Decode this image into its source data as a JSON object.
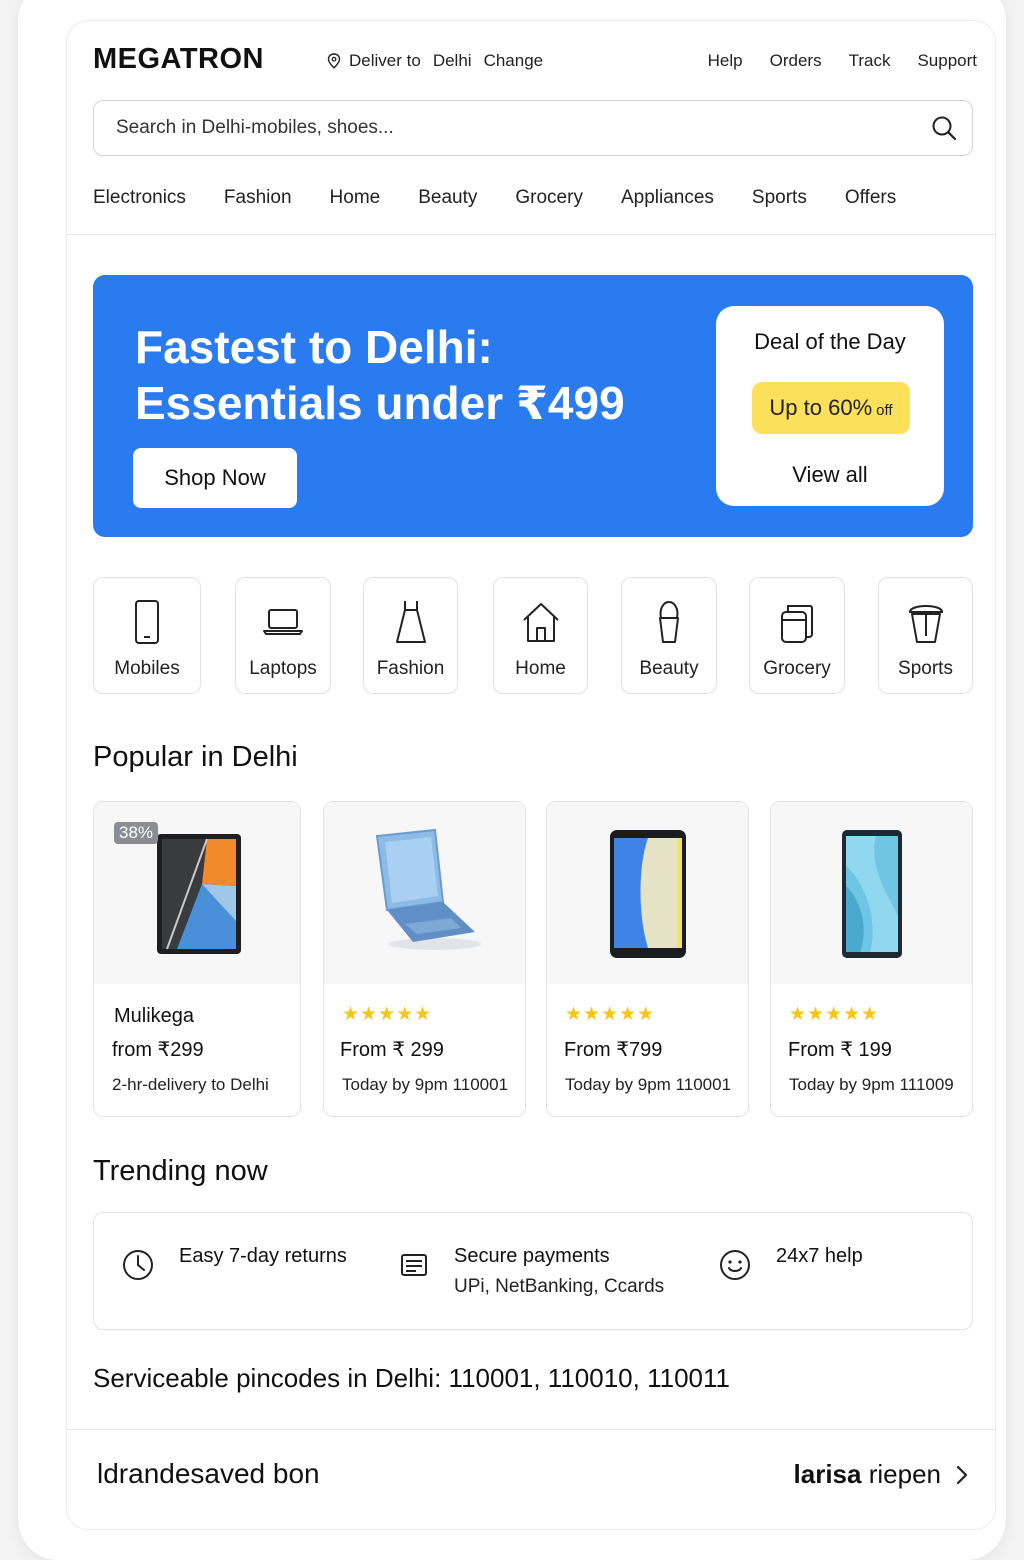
{
  "header": {
    "logo": "MEGATRON",
    "deliver_label": "Deliver to",
    "deliver_city": "Delhi",
    "change_label": "Change",
    "links": [
      "Help",
      "Orders",
      "Track",
      "Support"
    ]
  },
  "search": {
    "placeholder": "Search in Delhi-mobiles, shoes..."
  },
  "nav": [
    "Electronics",
    "Fashion",
    "Home",
    "Beauty",
    "Grocery",
    "Appliances",
    "Sports",
    "Offers"
  ],
  "hero": {
    "title_line1": "Fastest to Delhi:",
    "title_line2": "Essentials under ₹499",
    "cta": "Shop Now",
    "deal_title": "Deal of the Day",
    "deal_badge": "Up to 60%",
    "deal_badge_suffix": "off",
    "deal_link": "View all",
    "color": "#2a7bef",
    "badge_color": "#fde05a"
  },
  "categories": [
    {
      "label": "Mobiles",
      "icon": "mobile-icon"
    },
    {
      "label": "Laptops",
      "icon": "laptop-icon"
    },
    {
      "label": "Fashion",
      "icon": "dress-icon"
    },
    {
      "label": "Home",
      "icon": "home-icon"
    },
    {
      "label": "Beauty",
      "icon": "ice-cream-icon"
    },
    {
      "label": "Grocery",
      "icon": "grocery-jar-icon"
    },
    {
      "label": "Sports",
      "icon": "cup-icon"
    }
  ],
  "popular": {
    "title": "Popular in Delhi",
    "products": [
      {
        "badge": "38%",
        "name": "Mulikega",
        "price": "from ₹299",
        "delivery": "2-hr-delivery to Delhi",
        "image": "tablet-image"
      },
      {
        "rating": "★★★★★",
        "price": "From ₹ 299",
        "delivery": "Today by 9pm  110001",
        "image": "laptop-image"
      },
      {
        "rating": "★★★★★",
        "price": "From ₹799",
        "delivery": "Today by 9pm 110001",
        "image": "phone-image"
      },
      {
        "rating": "★★★★★",
        "price": "From ₹ 199",
        "delivery": "Today by 9pm 111009",
        "image": "phone-image"
      }
    ]
  },
  "trending": {
    "title": "Trending now",
    "items": [
      {
        "title": "Easy 7-day returns",
        "subtitle": "",
        "icon": "clock-icon"
      },
      {
        "title": "Secure payments",
        "subtitle": "UPi, NetBanking, Ccards",
        "icon": "receipt-icon"
      },
      {
        "title": "24x7 help",
        "subtitle": "",
        "icon": "smiley-icon"
      }
    ]
  },
  "pincodes": "Serviceable pincodes in Delhi: 110001, 110010, 110011",
  "footer": {
    "left": "ldrandesaved bon",
    "right_bold": "larisa",
    "right": "riepen"
  }
}
